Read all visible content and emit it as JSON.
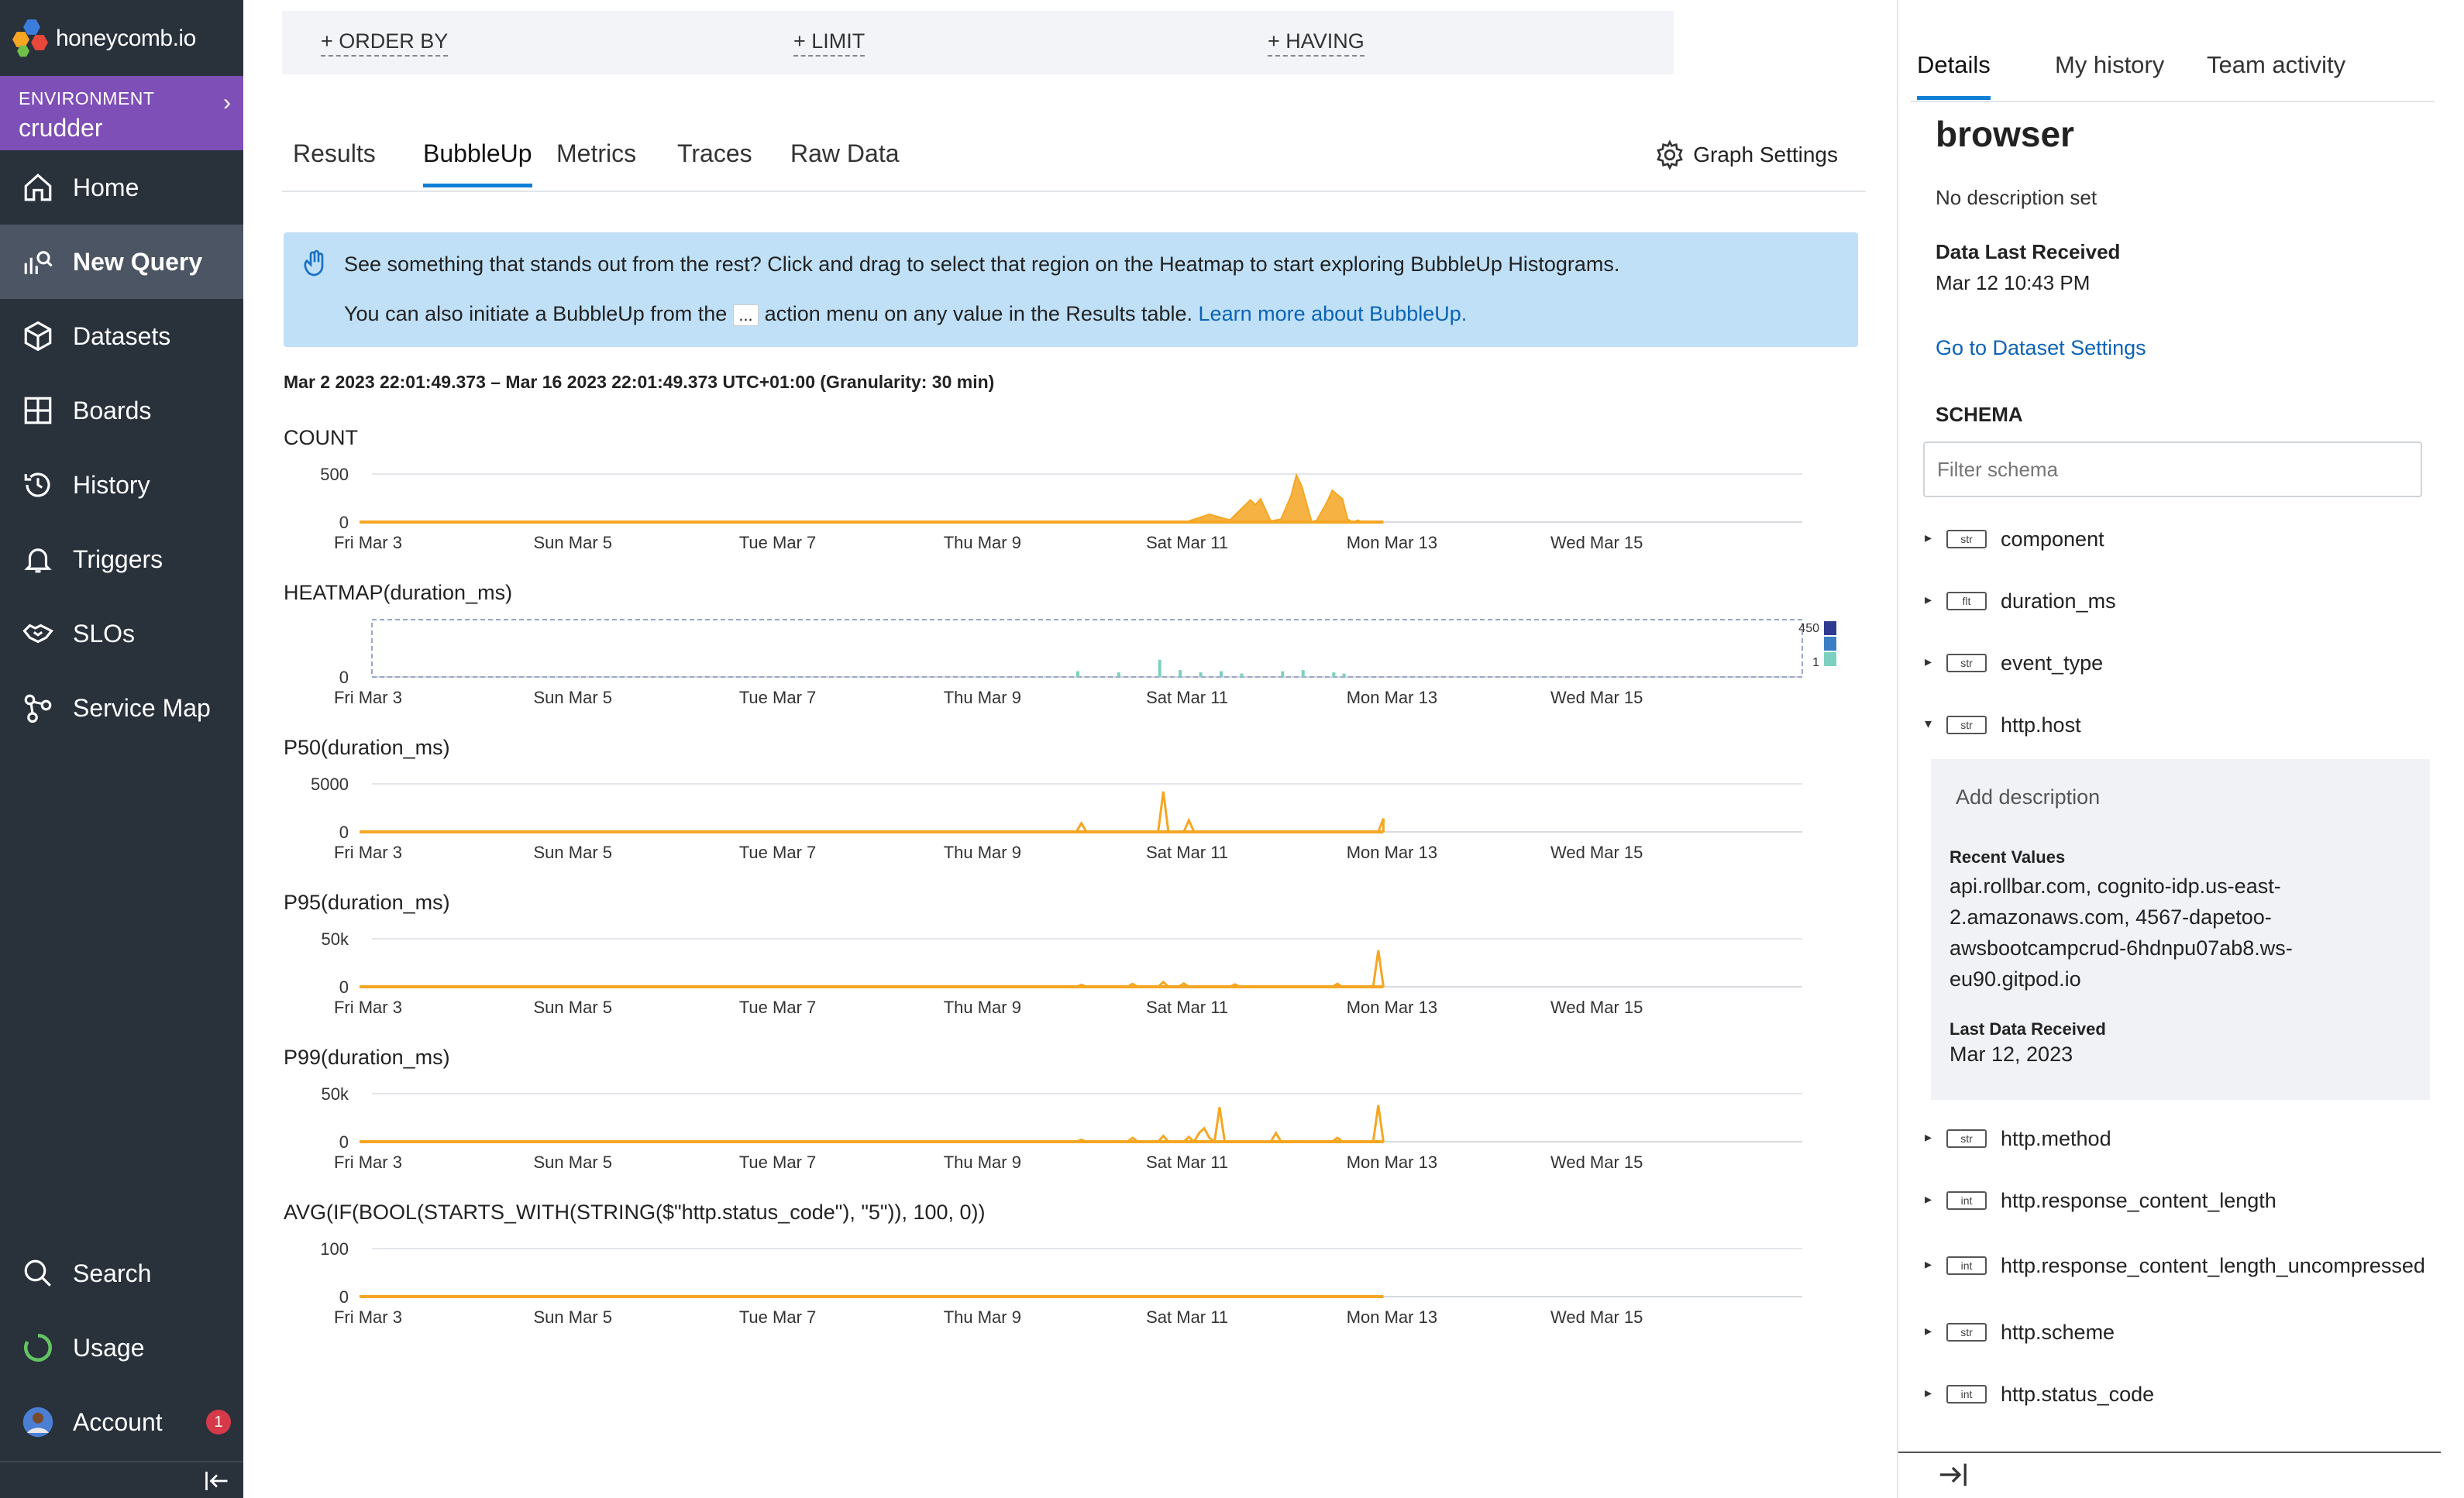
{
  "brand": {
    "name": "honeycomb.io"
  },
  "environment": {
    "label": "ENVIRONMENT",
    "name": "crudder"
  },
  "nav": {
    "home": "Home",
    "new_query": "New Query",
    "datasets": "Datasets",
    "boards": "Boards",
    "history": "History",
    "triggers": "Triggers",
    "slos": "SLOs",
    "service_map": "Service Map",
    "search": "Search",
    "usage": "Usage",
    "account": "Account",
    "account_badge": "1"
  },
  "query_clauses": {
    "order_by": "+ ORDER BY",
    "limit": "+ LIMIT",
    "having": "+ HAVING"
  },
  "tabs": [
    "Results",
    "BubbleUp",
    "Metrics",
    "Traces",
    "Raw Data"
  ],
  "active_tab": "BubbleUp",
  "graph_settings_label": "Graph Settings",
  "info_banner": {
    "line1": "See something that stands out from the rest? Click and drag to select that region on the Heatmap to start exploring BubbleUp Histograms.",
    "line2_before": "You can also initiate a BubbleUp from the",
    "dots": "...",
    "line2_after": "action menu on any value in the Results table.",
    "link": "Learn more about BubbleUp."
  },
  "time_range": "Mar 2 2023 22:01:49.373 – Mar 16 2023 22:01:49.373 UTC+01:00 (Granularity: 30 min)",
  "chart_data": [
    {
      "type": "area",
      "title": "COUNT",
      "x_labels": [
        "Fri Mar 3",
        "Sun Mar 5",
        "Tue Mar 7",
        "Thu Mar 9",
        "Sat Mar 11",
        "Mon Mar 13",
        "Wed Mar 15"
      ],
      "y_ticks": [
        "500",
        "0"
      ],
      "ylim": [
        0,
        500
      ],
      "color": "#f5a623",
      "series": [
        {
          "x": [
            7.4,
            8.0,
            8.1,
            8.3,
            8.5,
            8.7,
            8.75,
            8.8,
            8.9,
            9.0,
            9.1,
            9.15,
            9.2,
            9.3,
            9.35,
            9.45,
            9.5,
            9.6,
            9.65,
            9.7,
            9.75,
            9.8,
            9.9,
            10.0
          ],
          "y": [
            0,
            0,
            10,
            80,
            20,
            230,
            180,
            240,
            10,
            30,
            280,
            490,
            380,
            0,
            20,
            210,
            330,
            240,
            30,
            0,
            20,
            0,
            0,
            0
          ]
        }
      ]
    },
    {
      "type": "heatmap",
      "title": "HEATMAP(duration_ms)",
      "x_labels": [
        "Fri Mar 3",
        "Sun Mar 5",
        "Tue Mar 7",
        "Thu Mar 9",
        "Sat Mar 11",
        "Mon Mar 13",
        "Wed Mar 15"
      ],
      "y_ticks": [
        "0"
      ],
      "legend": [
        "450",
        "1"
      ],
      "colors": [
        "#2f3a91",
        "#3a7fc4",
        "#7dd0c0"
      ]
    },
    {
      "type": "line",
      "title": "P50(duration_ms)",
      "x_labels": [
        "Fri Mar 3",
        "Sun Mar 5",
        "Tue Mar 7",
        "Thu Mar 9",
        "Sat Mar 11",
        "Mon Mar 13",
        "Wed Mar 15"
      ],
      "y_ticks": [
        "5000",
        "0"
      ],
      "ylim": [
        0,
        5000
      ],
      "color": "#f5a623",
      "series": [
        {
          "x": [
            0,
            7.0,
            7.05,
            7.1,
            7.8,
            7.85,
            7.9,
            8.05,
            8.1,
            8.15,
            9.95,
            10.0,
            10.0
          ],
          "y": [
            0,
            0,
            900,
            0,
            0,
            4200,
            0,
            0,
            1200,
            0,
            0,
            1400,
            0
          ]
        }
      ]
    },
    {
      "type": "line",
      "title": "P95(duration_ms)",
      "x_labels": [
        "Fri Mar 3",
        "Sun Mar 5",
        "Tue Mar 7",
        "Thu Mar 9",
        "Sat Mar 11",
        "Mon Mar 13",
        "Wed Mar 15"
      ],
      "y_ticks": [
        "50k",
        "0"
      ],
      "ylim": [
        0,
        50000
      ],
      "color": "#f5a623",
      "series": [
        {
          "x": [
            0,
            7.0,
            7.05,
            7.1,
            7.5,
            7.55,
            7.6,
            7.8,
            7.85,
            7.9,
            8.0,
            8.05,
            8.1,
            8.5,
            8.55,
            8.6,
            9.5,
            9.55,
            9.6,
            9.9,
            9.95,
            10.0
          ],
          "y": [
            0,
            0,
            2000,
            0,
            0,
            3000,
            0,
            0,
            5000,
            0,
            0,
            3500,
            0,
            0,
            2500,
            0,
            0,
            3000,
            0,
            0,
            38000,
            0
          ]
        }
      ]
    },
    {
      "type": "line",
      "title": "P99(duration_ms)",
      "x_labels": [
        "Fri Mar 3",
        "Sun Mar 5",
        "Tue Mar 7",
        "Thu Mar 9",
        "Sat Mar 11",
        "Mon Mar 13",
        "Wed Mar 15"
      ],
      "y_ticks": [
        "50k",
        "0"
      ],
      "ylim": [
        0,
        50000
      ],
      "color": "#f5a623",
      "series": [
        {
          "x": [
            0,
            7.0,
            7.05,
            7.1,
            7.5,
            7.55,
            7.6,
            7.8,
            7.85,
            7.9,
            8.05,
            8.1,
            8.15,
            8.2,
            8.25,
            8.3,
            8.35,
            8.4,
            8.45,
            8.9,
            8.95,
            9.0,
            9.5,
            9.55,
            9.6,
            9.9,
            9.95,
            10.0
          ],
          "y": [
            0,
            0,
            2000,
            0,
            0,
            4000,
            0,
            0,
            6000,
            0,
            0,
            5000,
            0,
            9000,
            14000,
            4000,
            0,
            36000,
            0,
            0,
            9000,
            0,
            0,
            4000,
            0,
            0,
            38000,
            0
          ]
        }
      ]
    },
    {
      "type": "line",
      "title": "AVG(IF(BOOL(STARTS_WITH(STRING($\"http.status_code\"), \"5\")), 100, 0))",
      "x_labels": [
        "Fri Mar 3",
        "Sun Mar 5",
        "Tue Mar 7",
        "Thu Mar 9",
        "Sat Mar 11",
        "Mon Mar 13",
        "Wed Mar 15"
      ],
      "y_ticks": [
        "100",
        "0"
      ],
      "ylim": [
        0,
        100
      ],
      "color": "#f5a623",
      "series": [
        {
          "x": [
            0,
            10.0
          ],
          "y": [
            0,
            0
          ]
        }
      ]
    }
  ],
  "panel": {
    "tabs": [
      "Details",
      "My history",
      "Team activity"
    ],
    "dataset": "browser",
    "description": "No description set",
    "last_received_label": "Data Last Received",
    "last_received": "Mar 12 10:43 PM",
    "settings_link": "Go to Dataset Settings",
    "schema_heading": "SCHEMA",
    "filter_placeholder": "Filter schema",
    "fields": [
      {
        "type": "str",
        "name": "component"
      },
      {
        "type": "flt",
        "name": "duration_ms"
      },
      {
        "type": "str",
        "name": "event_type"
      },
      {
        "type": "str",
        "name": "http.host"
      },
      {
        "type": "str",
        "name": "http.method"
      },
      {
        "type": "int",
        "name": "http.response_content_length"
      },
      {
        "type": "int",
        "name": "http.response_content_length_uncompressed"
      },
      {
        "type": "str",
        "name": "http.scheme"
      },
      {
        "type": "int",
        "name": "http.status_code"
      }
    ],
    "expanded": {
      "add_description": "Add description",
      "recent_values_label": "Recent Values",
      "recent_values": "api.rollbar.com, cognito-idp.us-east-2.amazonaws.com, 4567-dapetoo-awsbootcampcrud-6hdnpu07ab8.ws-eu90.gitpod.io",
      "last_data_label": "Last Data Received",
      "last_data": "Mar 12, 2023"
    }
  }
}
